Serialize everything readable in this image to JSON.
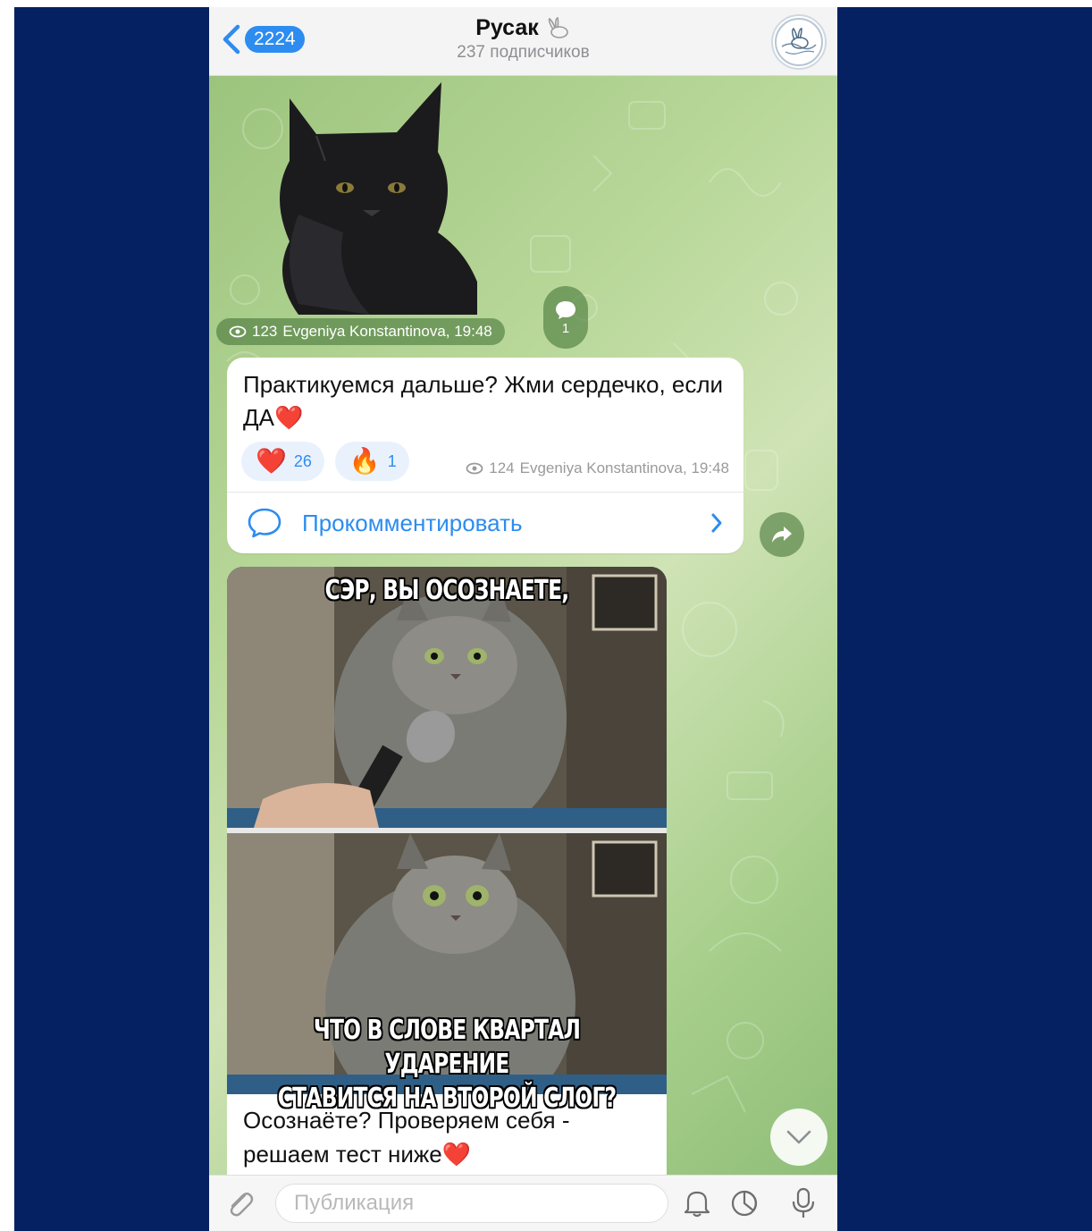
{
  "header": {
    "back_count": "2224",
    "channel_name": "Русак",
    "subscribers": "237 подписчиков",
    "avatar_icon": "rabbit-logo"
  },
  "sticker_post": {
    "views": "123",
    "author_time": "Evgeniya Konstantinova, 19:48",
    "comments_count": "1"
  },
  "text_post": {
    "text": "Практикуемся дальше? Жми сердечко, если ДА❤️",
    "reactions": [
      {
        "emoji": "❤️",
        "count": "26"
      },
      {
        "emoji": "🔥",
        "count": "1"
      }
    ],
    "views": "124",
    "author_time": "Evgeniya Konstantinova, 19:48",
    "comment_label": "Прокомментировать"
  },
  "meme_post": {
    "caption_top": "СЭР, ВЫ ОСОЗНАЕТЕ,",
    "caption_bottom_1": "ЧТО В СЛОВЕ КВАРТАЛ УДАРЕНИЕ",
    "caption_bottom_2": "СТАВИТСЯ НА ВТОРОЙ СЛОГ?",
    "text": "Осознаёте? Проверяем себя - решаем тест ниже❤️"
  },
  "bottom_bar": {
    "input_placeholder": "Публикация"
  },
  "colors": {
    "accent": "#2d8cf0",
    "frame": "#052162",
    "wallpaper": "#a9c98c"
  }
}
